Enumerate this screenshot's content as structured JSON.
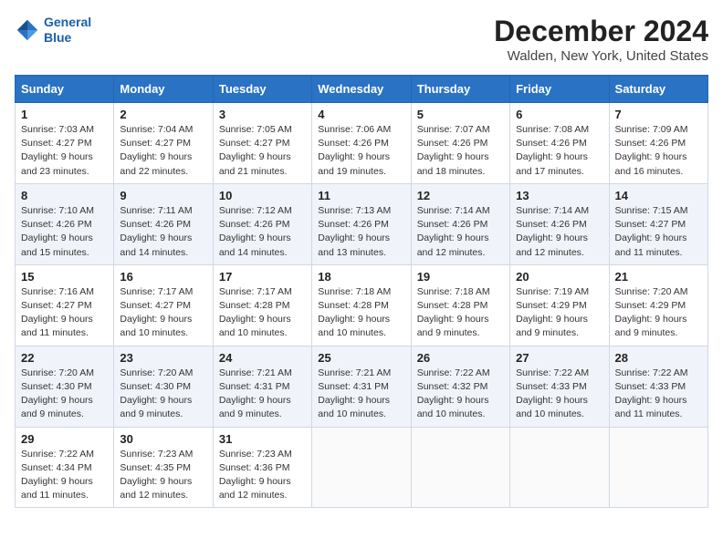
{
  "header": {
    "title": "December 2024",
    "subtitle": "Walden, New York, United States",
    "logo_line1": "General",
    "logo_line2": "Blue"
  },
  "days_of_week": [
    "Sunday",
    "Monday",
    "Tuesday",
    "Wednesday",
    "Thursday",
    "Friday",
    "Saturday"
  ],
  "weeks": [
    [
      {
        "day": 1,
        "info": "Sunrise: 7:03 AM\nSunset: 4:27 PM\nDaylight: 9 hours and 23 minutes."
      },
      {
        "day": 2,
        "info": "Sunrise: 7:04 AM\nSunset: 4:27 PM\nDaylight: 9 hours and 22 minutes."
      },
      {
        "day": 3,
        "info": "Sunrise: 7:05 AM\nSunset: 4:27 PM\nDaylight: 9 hours and 21 minutes."
      },
      {
        "day": 4,
        "info": "Sunrise: 7:06 AM\nSunset: 4:26 PM\nDaylight: 9 hours and 19 minutes."
      },
      {
        "day": 5,
        "info": "Sunrise: 7:07 AM\nSunset: 4:26 PM\nDaylight: 9 hours and 18 minutes."
      },
      {
        "day": 6,
        "info": "Sunrise: 7:08 AM\nSunset: 4:26 PM\nDaylight: 9 hours and 17 minutes."
      },
      {
        "day": 7,
        "info": "Sunrise: 7:09 AM\nSunset: 4:26 PM\nDaylight: 9 hours and 16 minutes."
      }
    ],
    [
      {
        "day": 8,
        "info": "Sunrise: 7:10 AM\nSunset: 4:26 PM\nDaylight: 9 hours and 15 minutes."
      },
      {
        "day": 9,
        "info": "Sunrise: 7:11 AM\nSunset: 4:26 PM\nDaylight: 9 hours and 14 minutes."
      },
      {
        "day": 10,
        "info": "Sunrise: 7:12 AM\nSunset: 4:26 PM\nDaylight: 9 hours and 14 minutes."
      },
      {
        "day": 11,
        "info": "Sunrise: 7:13 AM\nSunset: 4:26 PM\nDaylight: 9 hours and 13 minutes."
      },
      {
        "day": 12,
        "info": "Sunrise: 7:14 AM\nSunset: 4:26 PM\nDaylight: 9 hours and 12 minutes."
      },
      {
        "day": 13,
        "info": "Sunrise: 7:14 AM\nSunset: 4:26 PM\nDaylight: 9 hours and 12 minutes."
      },
      {
        "day": 14,
        "info": "Sunrise: 7:15 AM\nSunset: 4:27 PM\nDaylight: 9 hours and 11 minutes."
      }
    ],
    [
      {
        "day": 15,
        "info": "Sunrise: 7:16 AM\nSunset: 4:27 PM\nDaylight: 9 hours and 11 minutes."
      },
      {
        "day": 16,
        "info": "Sunrise: 7:17 AM\nSunset: 4:27 PM\nDaylight: 9 hours and 10 minutes."
      },
      {
        "day": 17,
        "info": "Sunrise: 7:17 AM\nSunset: 4:28 PM\nDaylight: 9 hours and 10 minutes."
      },
      {
        "day": 18,
        "info": "Sunrise: 7:18 AM\nSunset: 4:28 PM\nDaylight: 9 hours and 10 minutes."
      },
      {
        "day": 19,
        "info": "Sunrise: 7:18 AM\nSunset: 4:28 PM\nDaylight: 9 hours and 9 minutes."
      },
      {
        "day": 20,
        "info": "Sunrise: 7:19 AM\nSunset: 4:29 PM\nDaylight: 9 hours and 9 minutes."
      },
      {
        "day": 21,
        "info": "Sunrise: 7:20 AM\nSunset: 4:29 PM\nDaylight: 9 hours and 9 minutes."
      }
    ],
    [
      {
        "day": 22,
        "info": "Sunrise: 7:20 AM\nSunset: 4:30 PM\nDaylight: 9 hours and 9 minutes."
      },
      {
        "day": 23,
        "info": "Sunrise: 7:20 AM\nSunset: 4:30 PM\nDaylight: 9 hours and 9 minutes."
      },
      {
        "day": 24,
        "info": "Sunrise: 7:21 AM\nSunset: 4:31 PM\nDaylight: 9 hours and 9 minutes."
      },
      {
        "day": 25,
        "info": "Sunrise: 7:21 AM\nSunset: 4:31 PM\nDaylight: 9 hours and 10 minutes."
      },
      {
        "day": 26,
        "info": "Sunrise: 7:22 AM\nSunset: 4:32 PM\nDaylight: 9 hours and 10 minutes."
      },
      {
        "day": 27,
        "info": "Sunrise: 7:22 AM\nSunset: 4:33 PM\nDaylight: 9 hours and 10 minutes."
      },
      {
        "day": 28,
        "info": "Sunrise: 7:22 AM\nSunset: 4:33 PM\nDaylight: 9 hours and 11 minutes."
      }
    ],
    [
      {
        "day": 29,
        "info": "Sunrise: 7:22 AM\nSunset: 4:34 PM\nDaylight: 9 hours and 11 minutes."
      },
      {
        "day": 30,
        "info": "Sunrise: 7:23 AM\nSunset: 4:35 PM\nDaylight: 9 hours and 12 minutes."
      },
      {
        "day": 31,
        "info": "Sunrise: 7:23 AM\nSunset: 4:36 PM\nDaylight: 9 hours and 12 minutes."
      },
      null,
      null,
      null,
      null
    ]
  ]
}
